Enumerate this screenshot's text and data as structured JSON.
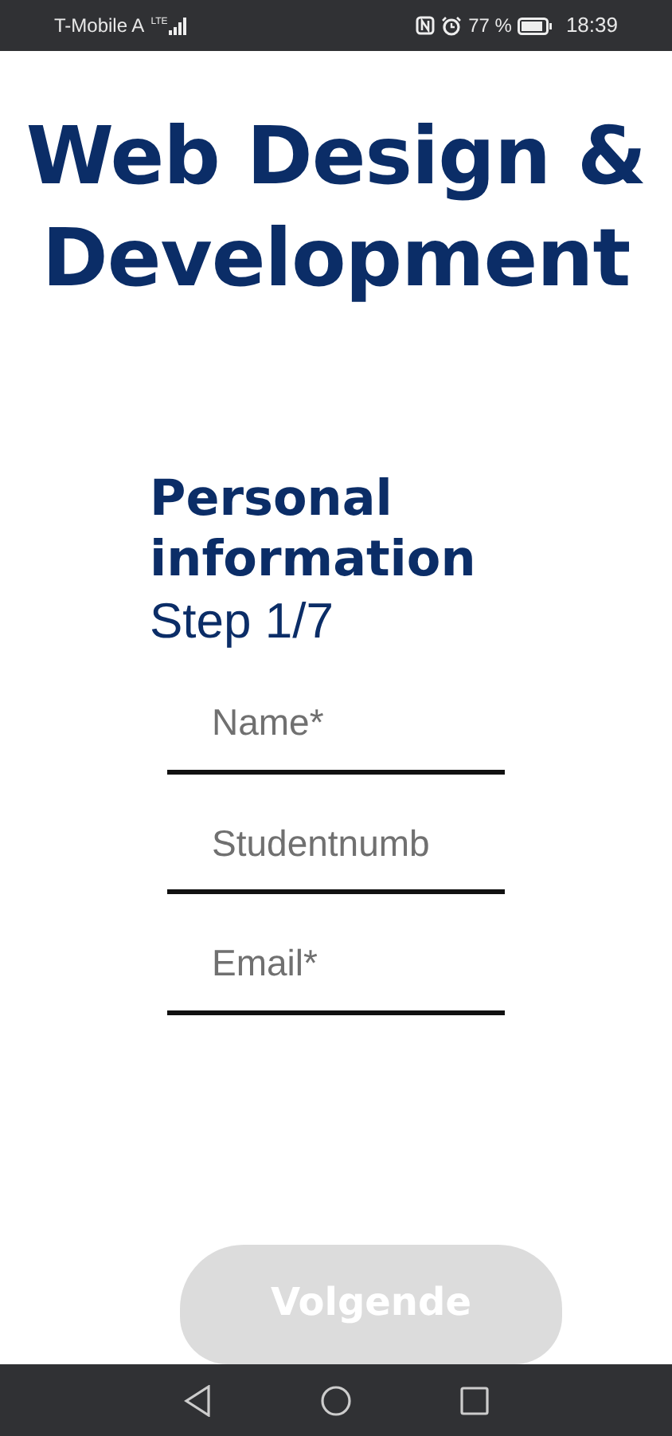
{
  "status_bar": {
    "carrier": "T-Mobile A",
    "network": "LTE",
    "battery": "77 %",
    "time": "18:39"
  },
  "title": "Web Design & Development",
  "section": {
    "heading": "Personal information",
    "step": "Step 1/7"
  },
  "fields": [
    {
      "placeholder": "Name*"
    },
    {
      "placeholder": "Studentnumb"
    },
    {
      "placeholder": "Email*"
    }
  ],
  "next_button": {
    "label": "Volgende",
    "disabled": true
  }
}
